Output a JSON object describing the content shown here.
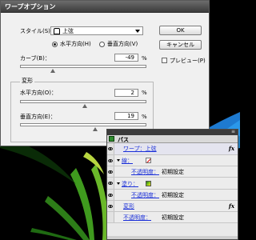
{
  "dialog": {
    "title": "ワープオプション",
    "style_label": "スタイル(S)：",
    "style_value": "上弦",
    "orientation": {
      "horizontal_label": "水平方向(H)",
      "vertical_label": "垂直方向(V)",
      "selected": "horizontal"
    },
    "bend_label": "カーブ(B)：",
    "bend_value": "-49",
    "bend_fraction": 0.255,
    "percent": "%",
    "distortion_label": "変形",
    "h_distortion_label": "水平方向(O)：",
    "h_distortion_value": "2",
    "h_distortion_fraction": 0.51,
    "v_distortion_label": "垂直方向(E)：",
    "v_distortion_value": "19",
    "v_distortion_fraction": 0.595,
    "ok_label": "OK",
    "cancel_label": "キャンセル",
    "preview_label": "プレビュー(P)",
    "preview_checked": false
  },
  "panel": {
    "menu_icon": "≡",
    "tab_label": "パス",
    "rows": {
      "warp": "ワープ：上弦",
      "fx": "fx",
      "stroke": "線：",
      "stroke_opacity_link": "不透明度：",
      "stroke_opacity_value": "初期設定",
      "fill": "塗り：",
      "fill_opacity_link": "不透明度：",
      "fill_opacity_value": "初期設定",
      "transform_link": "変形",
      "transform_fx": "fx",
      "opacity_link": "不透明度：",
      "opacity_value": "初期設定"
    }
  }
}
